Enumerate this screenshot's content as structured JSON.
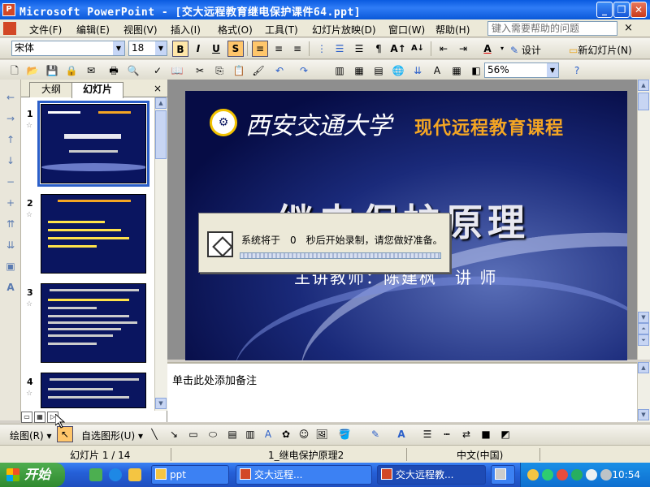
{
  "window": {
    "app_icon_text": "P",
    "title": "Microsoft PowerPoint - [交大远程教育继电保护课件64.ppt]",
    "buttons": [
      "_",
      "❐",
      "✕"
    ]
  },
  "menu": {
    "items": [
      "文件(F)",
      "编辑(E)",
      "视图(V)",
      "插入(I)",
      "格式(O)",
      "工具(T)",
      "幻灯片放映(D)",
      "窗口(W)",
      "帮助(H)"
    ],
    "help_placeholder": "键入需要帮助的问题",
    "doc_close": "×"
  },
  "format_toolbar": {
    "font": "宋体",
    "size": "18",
    "bold": "B",
    "italic": "I",
    "underline": "U",
    "shadow": "S",
    "design_label": "设计",
    "new_slide_label": "新幻灯片(N)"
  },
  "standard_toolbar": {
    "zoom": "56%"
  },
  "pane": {
    "tab_outline": "大纲",
    "tab_slides": "幻灯片",
    "close": "×",
    "slides": [
      {
        "num": "1",
        "selected": true
      },
      {
        "num": "2",
        "selected": false
      },
      {
        "num": "3",
        "selected": false
      },
      {
        "num": "4",
        "selected": false
      }
    ]
  },
  "slide": {
    "university": "西安交通大学",
    "course": "现代远程教育课程",
    "title": "继电保护原理",
    "lecturer": "主讲教师：陈建枫　讲 师"
  },
  "dialog": {
    "message": "系统将于　0　秒后开始录制，请您做好准备。",
    "progress_fraction": 1.0
  },
  "notes": {
    "placeholder": "单击此处添加备注"
  },
  "draw_toolbar": {
    "draw_label": "绘图(R)",
    "autoshapes_label": "自选图形(U)"
  },
  "status": {
    "slide_counter": "幻灯片 1 / 14",
    "design_name": "1_继电保护原理2",
    "language": "中文(中国)"
  },
  "taskbar": {
    "start_label": "开始",
    "buttons": [
      {
        "label": "ppt",
        "active": false
      },
      {
        "label": "交大远程...",
        "active": false
      },
      {
        "label": "交大远程教...",
        "active": true
      },
      {
        "label": "",
        "active": false
      }
    ],
    "clock": "10:54"
  },
  "colors": {
    "titlebar": "#0a5be0",
    "slide_bg": "#0a1560",
    "course_text": "#f5a623",
    "taskbar": "#2560d8",
    "start_button": "#3a9a3a"
  }
}
